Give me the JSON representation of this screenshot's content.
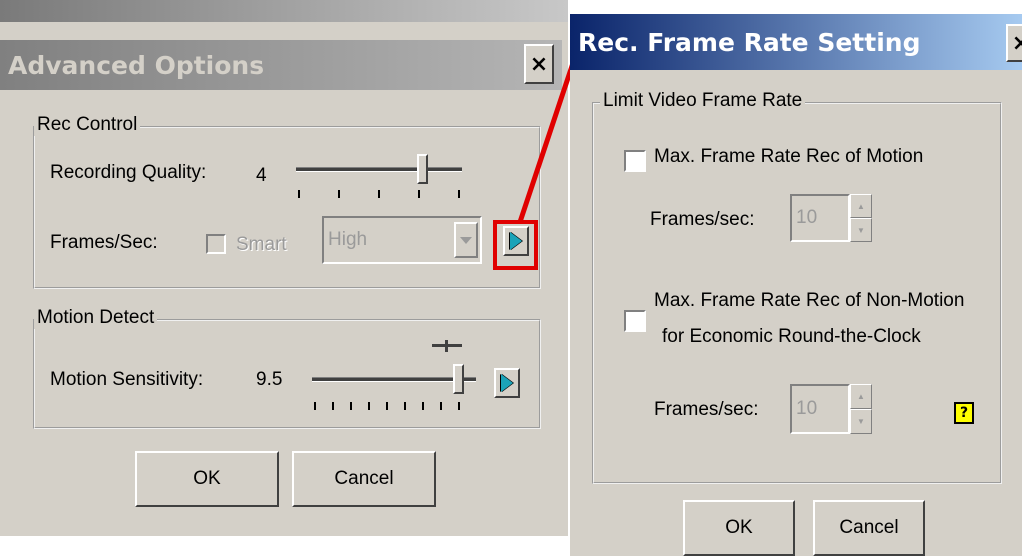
{
  "colors": {
    "callout_red": "#e00000",
    "dialog_bg": "#d4d0c8"
  },
  "advanced": {
    "title": "Advanced Options",
    "close": "×",
    "rec_control": {
      "legend": "Rec Control",
      "quality_label": "Recording Quality:",
      "quality_value": "4",
      "quality_level": 0.82,
      "fps_label": "Frames/Sec:",
      "smart_label": "Smart",
      "fps_select_value": "High"
    },
    "motion_detect": {
      "legend": "Motion Detect",
      "sensitivity_label": "Motion Sensitivity:",
      "sensitivity_value": "9.5",
      "sensitivity_level": 0.95
    },
    "ok": "OK",
    "cancel": "Cancel",
    "arrow_icon": "play-arrow-icon"
  },
  "frame_rate": {
    "title": "Rec. Frame Rate Setting",
    "close": "×",
    "group_legend": "Limit Video Frame Rate",
    "motion_checkbox_label": "Max. Frame Rate Rec of Motion",
    "motion_fps_label": "Frames/sec:",
    "motion_fps_value": "10",
    "nonmotion_label_line1": "Max. Frame Rate Rec of Non-Motion",
    "nonmotion_label_line2": "for Economic  Round-the-Clock",
    "nonmotion_fps_label": "Frames/sec:",
    "nonmotion_fps_value": "10",
    "help_icon_text": "?",
    "ok": "OK",
    "cancel": "Cancel"
  }
}
